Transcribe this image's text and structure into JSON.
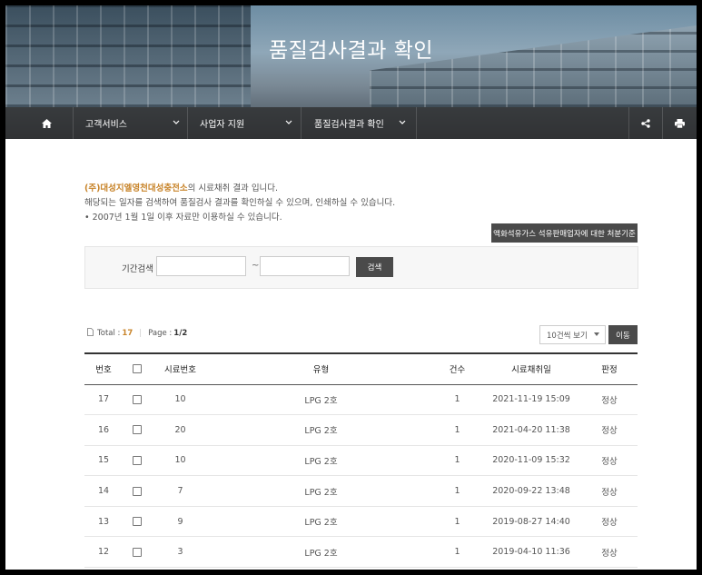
{
  "hero": {
    "title": "품질검사결과 확인"
  },
  "nav": {
    "items": [
      {
        "label": "고객서비스"
      },
      {
        "label": "사업자 지원"
      },
      {
        "label": "품질검사결과 확인"
      }
    ]
  },
  "intro": {
    "org_name": "(주)대성지엘영천대성충전소",
    "line1_suffix": "의 시료채취 결과 입니다.",
    "line2": "해당되는 일자를 검색하여 품질검사 결과를 확인하실 수 있으며, 인쇄하실 수 있습니다.",
    "line3": "• 2007년 1월 1일 이후 자료만 이용하실 수 있습니다."
  },
  "criteria_button": "액화석유가스 석유판매업자에 대한 처분기준",
  "search": {
    "label": "기간검색",
    "start_value": "",
    "end_value": "",
    "tilde": "~",
    "button": "검색"
  },
  "meta": {
    "total_label": "Total :",
    "total_value": "17",
    "page_label": "Page :",
    "page_value": "1/2"
  },
  "page_size": {
    "selected": "10건씩 보기"
  },
  "go_button": "이동",
  "table": {
    "headers": [
      "번호",
      "",
      "시료번호",
      "유형",
      "건수",
      "시료채취일",
      "판정"
    ],
    "rows": [
      {
        "no": "17",
        "sample": "10",
        "type": "LPG 2호",
        "count": "1",
        "date": "2021-11-19 15:09",
        "result": "정상"
      },
      {
        "no": "16",
        "sample": "20",
        "type": "LPG 2호",
        "count": "1",
        "date": "2021-04-20 11:38",
        "result": "정상"
      },
      {
        "no": "15",
        "sample": "10",
        "type": "LPG 2호",
        "count": "1",
        "date": "2020-11-09 15:32",
        "result": "정상"
      },
      {
        "no": "14",
        "sample": "7",
        "type": "LPG 2호",
        "count": "1",
        "date": "2020-09-22 13:48",
        "result": "정상"
      },
      {
        "no": "13",
        "sample": "9",
        "type": "LPG 2호",
        "count": "1",
        "date": "2019-08-27 14:40",
        "result": "정상"
      },
      {
        "no": "12",
        "sample": "3",
        "type": "LPG 2호",
        "count": "1",
        "date": "2019-04-10 11:36",
        "result": "정상"
      }
    ]
  },
  "icons": {
    "home": "home-icon",
    "share": "share-icon",
    "print": "print-icon",
    "file": "file-icon"
  },
  "colors": {
    "accent": "#c8842a",
    "dark_button": "#4a4a4a",
    "nav_bg": "#2d2d2d"
  }
}
